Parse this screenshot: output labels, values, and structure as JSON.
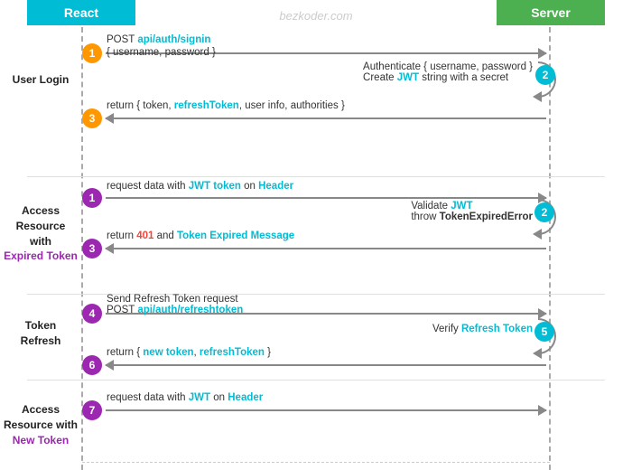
{
  "watermark": "bezkoder.com",
  "header": {
    "react_label": "React",
    "server_label": "Server"
  },
  "sections": [
    {
      "id": "user-login",
      "label": "User\nLogin",
      "purple": false
    },
    {
      "id": "access-expired",
      "label": "Access\nResource\nwith\nExpired Token",
      "purple": true,
      "purple_text": "Expired Token"
    },
    {
      "id": "token-refresh",
      "label": "Token\nRefresh",
      "purple": false
    },
    {
      "id": "access-new",
      "label": "Access\nResource with\nNew Token",
      "purple": true,
      "purple_text": "New Token"
    }
  ],
  "steps": [
    {
      "num": "1",
      "color": "orange",
      "direction": "right",
      "text": "POST api/auth/signin",
      "subtext": "{ username, password }",
      "highlight": "teal"
    },
    {
      "num": "2",
      "color": "teal",
      "direction": "curve",
      "text": "Authenticate { username, password }",
      "subtext": "Create JWT string with a secret",
      "highlight": "teal"
    },
    {
      "num": "3",
      "color": "orange",
      "direction": "left",
      "text": "return { token, refreshToken, user info, authorities }",
      "highlight": "teal"
    },
    {
      "num": "1",
      "color": "purple-bg",
      "direction": "right",
      "text": "request data with JWT token on Header",
      "highlight_words": [
        {
          "word": "JWT token",
          "color": "teal"
        },
        {
          "word": "Header",
          "color": "teal"
        }
      ]
    },
    {
      "num": "2",
      "color": "teal",
      "direction": "curve",
      "text": "Validate JWT",
      "subtext": "throw TokenExpiredError",
      "highlight": "teal"
    },
    {
      "num": "3",
      "color": "purple-bg",
      "direction": "left",
      "text": "return 401 and Token Expired Message",
      "highlight_words": [
        {
          "word": "401",
          "color": "red"
        },
        {
          "word": "Token Expired Message",
          "color": "teal"
        }
      ]
    },
    {
      "num": "4",
      "color": "purple-bg",
      "direction": "right",
      "text": "Send Refresh Token request",
      "subtext": "POST api/auth/refreshtoken",
      "highlight": "teal"
    },
    {
      "num": "5",
      "color": "teal",
      "direction": "curve",
      "text": "Verify Refresh Token",
      "highlight": "teal"
    },
    {
      "num": "6",
      "color": "purple-bg",
      "direction": "left",
      "text": "return { new token, refreshToken }",
      "highlight": "teal"
    },
    {
      "num": "7",
      "color": "purple-bg",
      "direction": "right",
      "text": "request data with JWT on Header",
      "highlight": "teal"
    }
  ],
  "colors": {
    "teal": "#00bcd4",
    "orange": "#ff9800",
    "purple": "#9c27b0",
    "green": "#4caf50",
    "red": "#f44336"
  }
}
